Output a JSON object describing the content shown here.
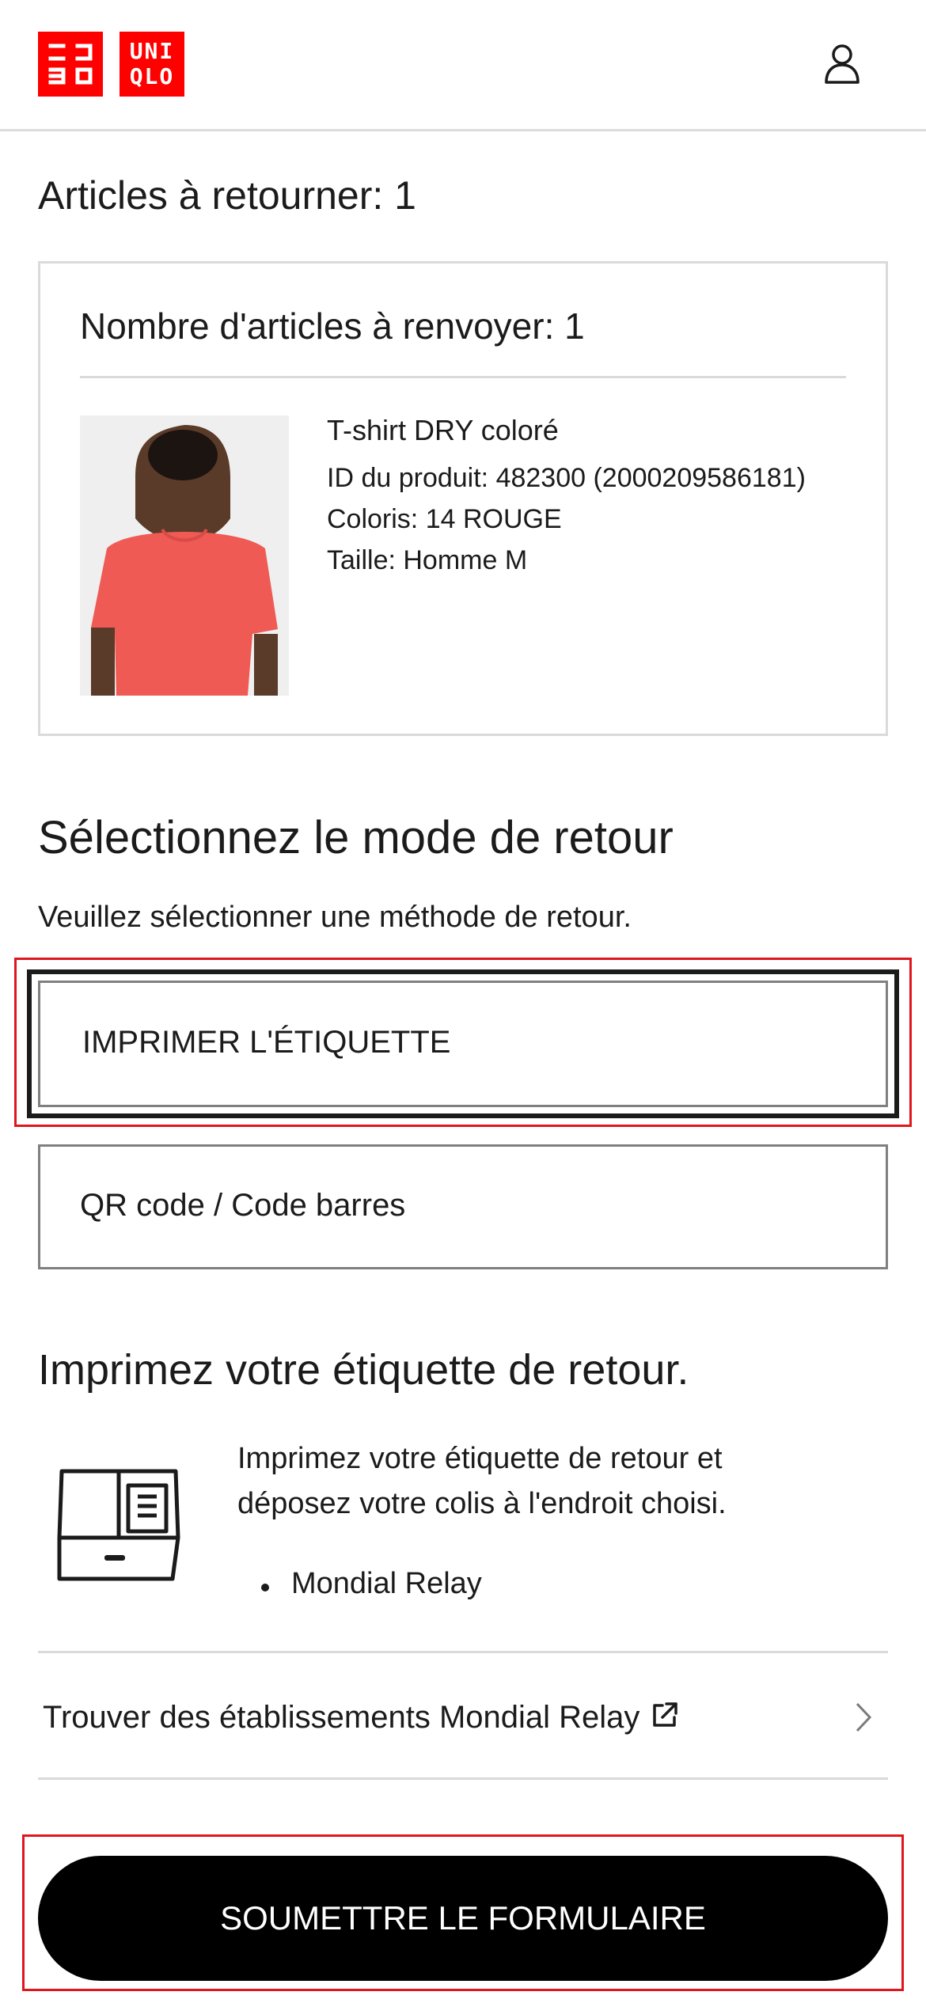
{
  "header": {
    "logo_top": "UNI",
    "logo_bottom": "QLO",
    "account_icon": "user-icon"
  },
  "articles": {
    "heading": "Articles à retourner: 1",
    "card_title": "Nombre d'articles à renvoyer: 1",
    "product": {
      "name": "T-shirt DRY coloré",
      "id_line": "ID du produit: 482300 (2000209586181)",
      "color_line": "Coloris: 14 ROUGE",
      "size_line": "Taille: Homme M"
    }
  },
  "return_mode": {
    "heading": "Sélectionnez le mode de retour",
    "description": "Veuillez sélectionner une méthode de retour.",
    "options": [
      {
        "label": "IMPRIMER L'ÉTIQUETTE",
        "selected": true
      },
      {
        "label": "QR code / Code barres",
        "selected": false
      }
    ]
  },
  "print_section": {
    "heading": "Imprimez votre étiquette de retour.",
    "description": "Imprimez votre étiquette de retour et déposez votre colis à l'endroit choisi.",
    "carriers": [
      "Mondial Relay"
    ],
    "icon": "package-box-icon"
  },
  "find_link": {
    "label": "Trouver des établissements Mondial Relay",
    "icon": "external-link-icon"
  },
  "submit": {
    "label": "SOUMETTRE LE FORMULAIRE"
  },
  "colors": {
    "brand_red": "#ff0000",
    "highlight": "#e0161e",
    "shirt": "#ef5a55"
  }
}
